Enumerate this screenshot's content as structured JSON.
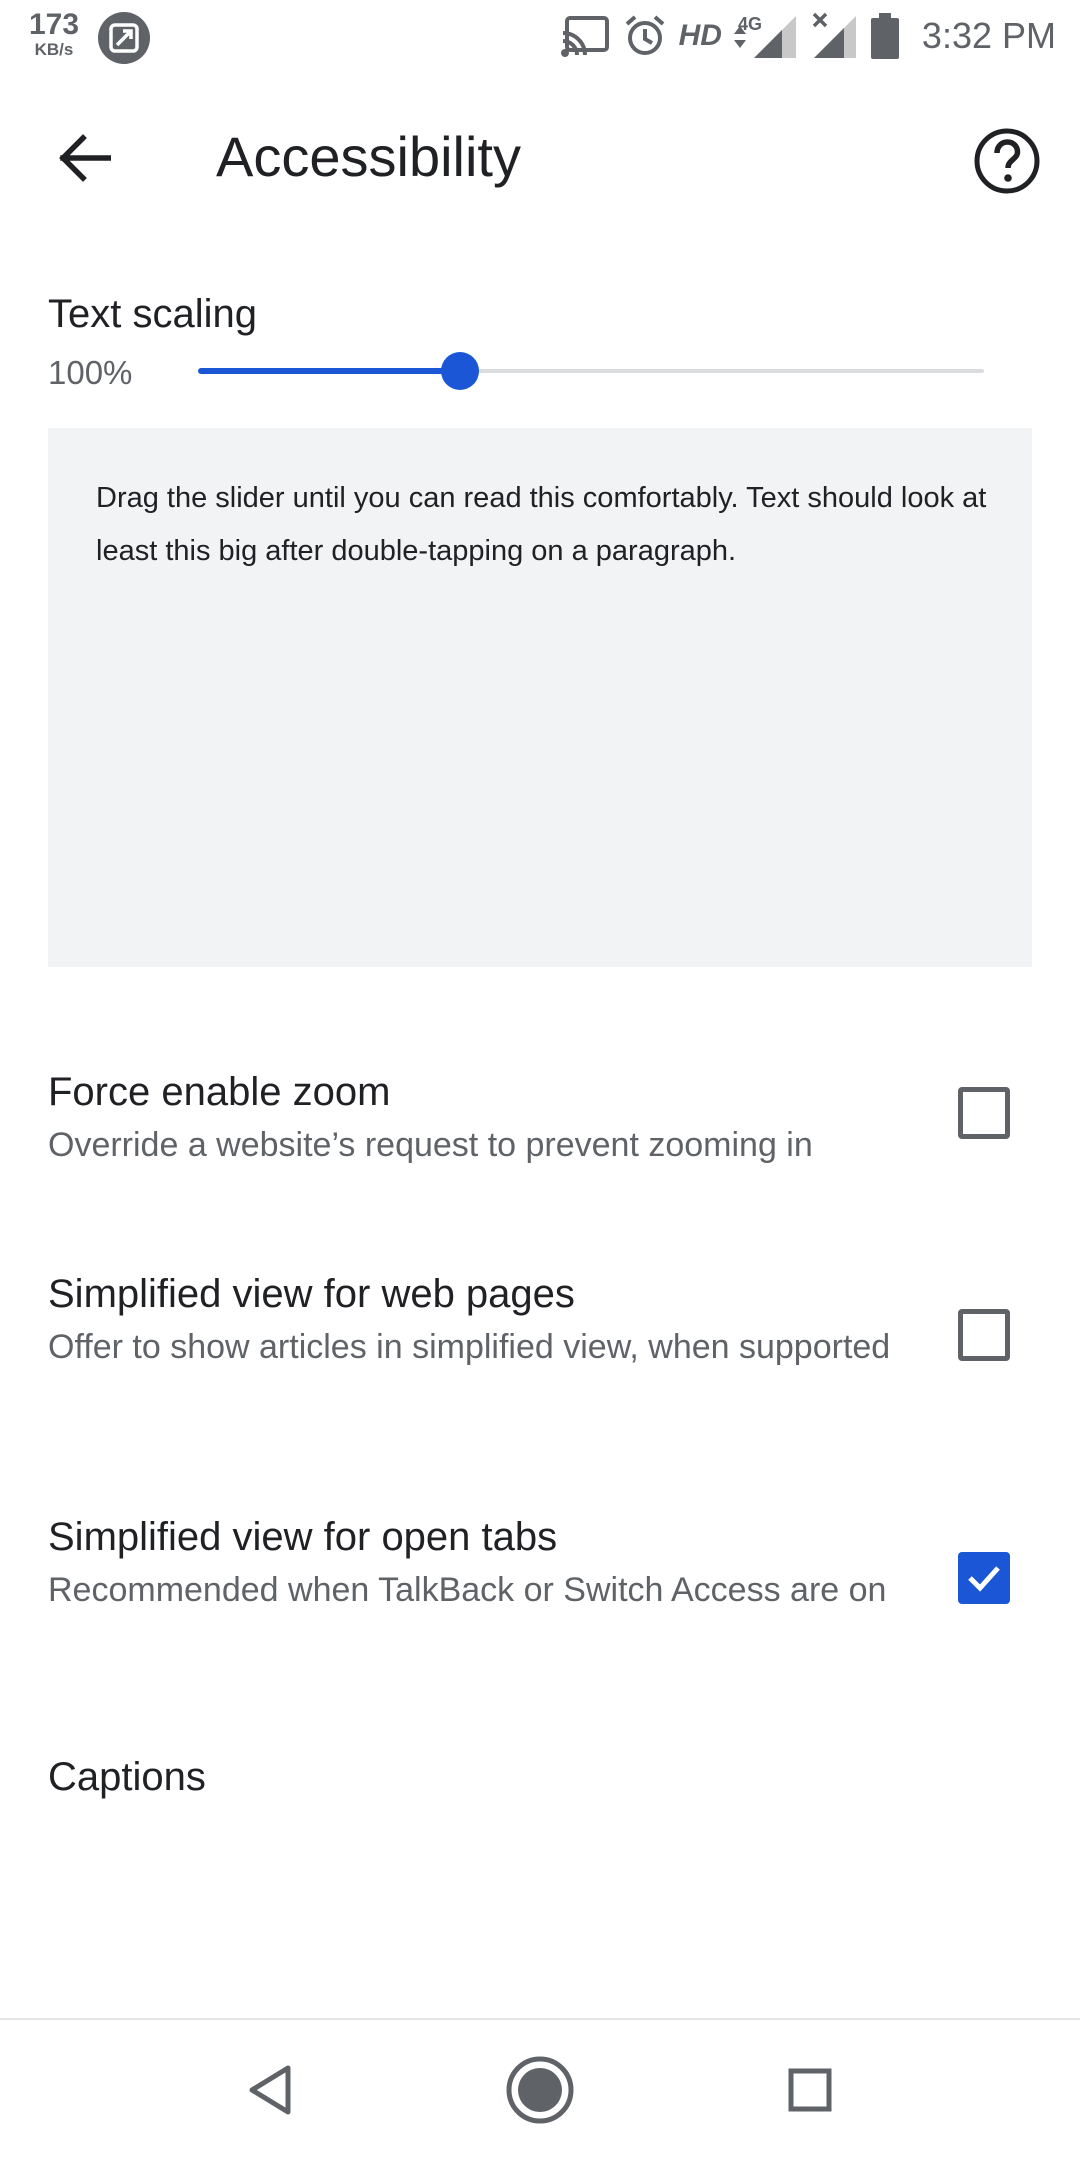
{
  "status_bar": {
    "net_speed_value": "173",
    "net_speed_unit": "KB/s",
    "network_label": "HD",
    "network_type": "4G",
    "time": "3:32 PM",
    "icons": [
      "cast-icon",
      "alarm-icon",
      "signal-icon",
      "signal-no-data-icon",
      "battery-icon"
    ]
  },
  "app_bar": {
    "title": "Accessibility",
    "back_icon": "arrow-back-icon",
    "help_icon": "help-circle-icon"
  },
  "text_scaling": {
    "title": "Text scaling",
    "value_label": "100%",
    "slider_fraction": 0.333,
    "accent_color": "#1a56d6",
    "preview_text": "Drag the slider until you can read this comfortably. Text should look at least this big after double-tapping on a paragraph."
  },
  "preferences": [
    {
      "title": "Force enable zoom",
      "summary": "Override a website’s request to prevent zooming in",
      "checked": false
    },
    {
      "title": "Simplified view for web pages",
      "summary": "Offer to show articles in simplified view, when supported",
      "checked": false
    },
    {
      "title": "Simplified view for open tabs",
      "summary": "Recommended when TalkBack or Switch Access are on",
      "checked": true
    }
  ],
  "captions": {
    "title": "Captions"
  },
  "nav_bar": {
    "icons": [
      "back-triangle-icon",
      "home-circle-icon",
      "recents-square-icon"
    ]
  }
}
